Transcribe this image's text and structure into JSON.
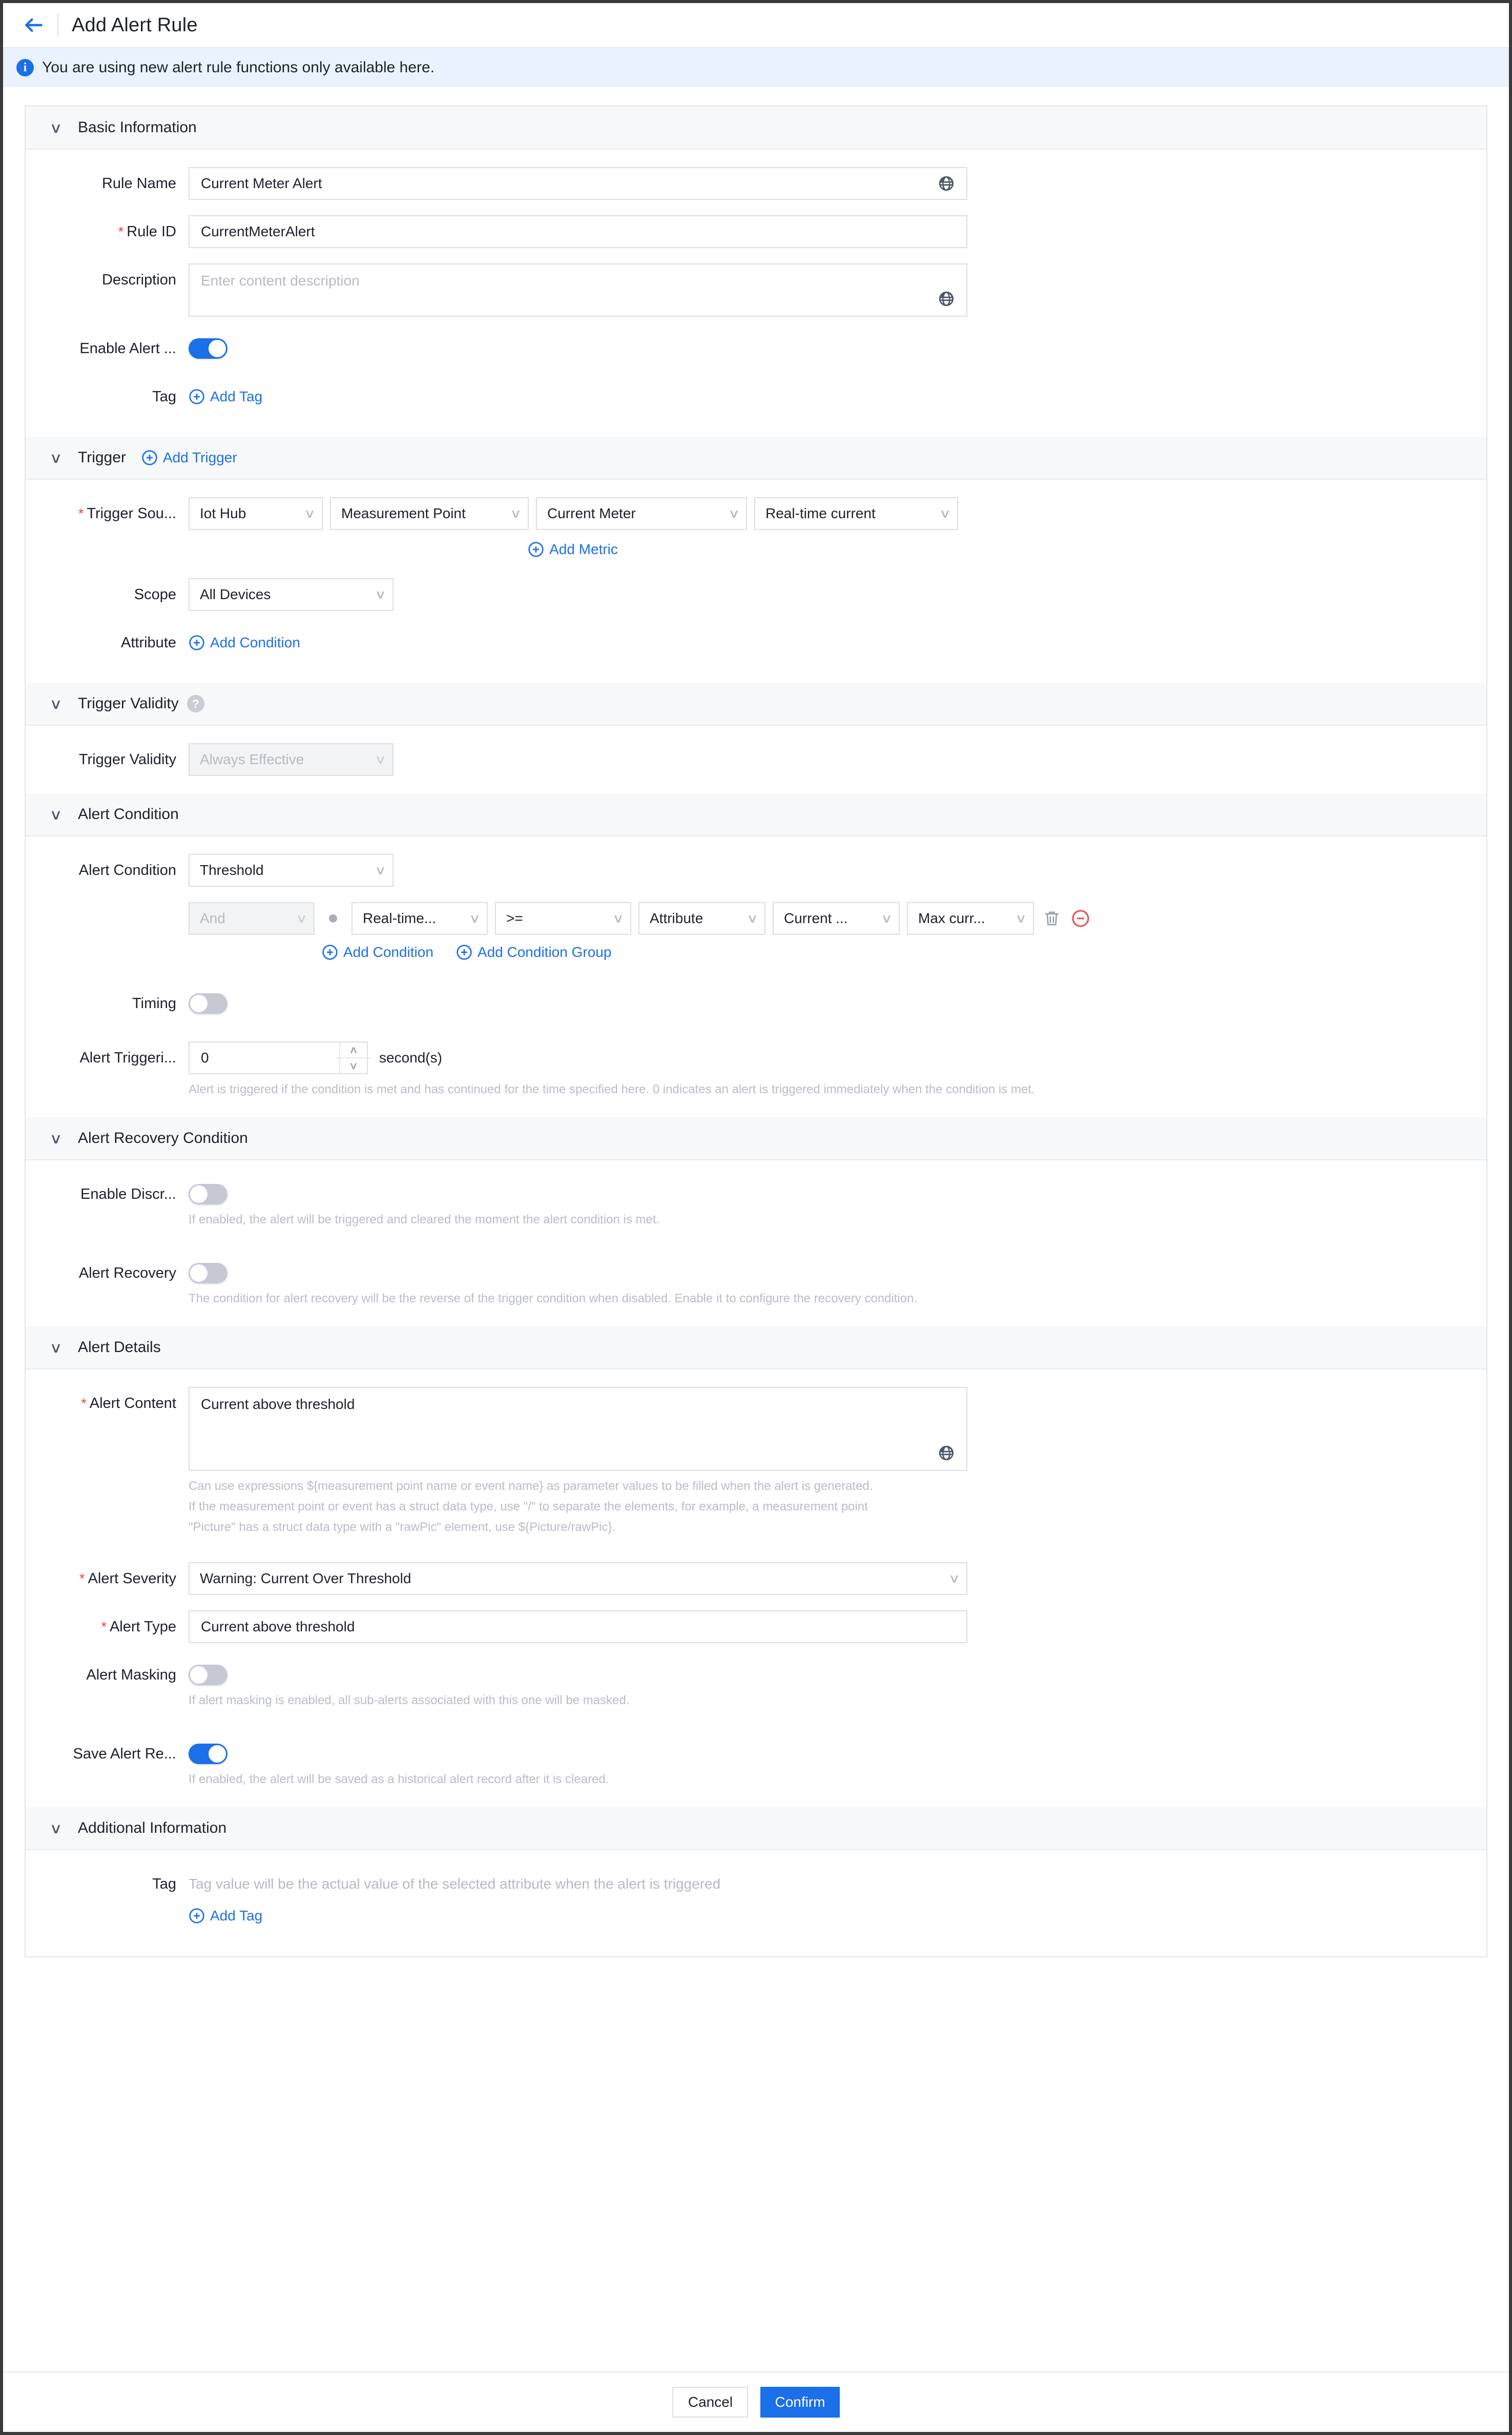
{
  "header": {
    "title": "Add Alert Rule",
    "back_icon": "arrow-left-icon"
  },
  "notice": {
    "icon": "info-icon",
    "text": "You are using new alert rule functions only available here."
  },
  "sections": {
    "basic": {
      "title": "Basic Information",
      "rule_name_label": "Rule Name",
      "rule_name_value": "Current Meter Alert",
      "rule_id_label": "Rule ID",
      "rule_id_value": "CurrentMeterAlert",
      "description_label": "Description",
      "description_placeholder": "Enter content description",
      "enable_alert_label": "Enable Alert ...",
      "enable_alert_state": "on",
      "tag_label": "Tag",
      "add_tag_label": "Add Tag"
    },
    "trigger": {
      "title": "Trigger",
      "add_trigger_label": "Add Trigger",
      "trigger_source_label": "Trigger Sou...",
      "source_1": "Iot Hub",
      "source_2": "Measurement Point",
      "source_3": "Current Meter",
      "source_4": "Real-time current",
      "add_metric_label": "Add Metric",
      "scope_label": "Scope",
      "scope_value": "All Devices",
      "attribute_label": "Attribute",
      "add_condition_label": "Add Condition"
    },
    "trigger_validity": {
      "title": "Trigger Validity",
      "field_label": "Trigger Validity",
      "value": "Always Effective"
    },
    "alert_condition": {
      "title": "Alert Condition",
      "field_label": "Alert Condition",
      "type_value": "Threshold",
      "logic_value": "And",
      "metric_value": "Real-time...",
      "operator_value": ">=",
      "source_value": "Attribute",
      "object_value": "Current ...",
      "attribute_value": "Max curr...",
      "delete_icon": "trash-icon",
      "remove_icon": "minus-circle-icon",
      "add_condition_label": "Add Condition",
      "add_condition_group_label": "Add Condition Group",
      "timing_label": "Timing",
      "timing_state": "off",
      "trigger_time_label": "Alert Triggeri...",
      "trigger_time_value": "0",
      "trigger_time_unit": "second(s)",
      "trigger_time_help": "Alert is triggered if the condition is met and has continued for the time specified here. 0 indicates an alert is triggered immediately when the condition is met."
    },
    "alert_recovery": {
      "title": "Alert Recovery Condition",
      "discrete_label": "Enable Discr...",
      "discrete_state": "off",
      "discrete_help": "If enabled, the alert will be triggered and cleared the moment the alert condition is met.",
      "recovery_label": "Alert Recovery",
      "recovery_state": "off",
      "recovery_help": "The condition for alert recovery will be the reverse of the trigger condition when disabled. Enable it to configure the recovery condition."
    },
    "alert_details": {
      "title": "Alert Details",
      "content_label": "Alert Content",
      "content_value": "Current above threshold",
      "content_help_1": "Can use expressions ${measurement point name or event name} as parameter values to be filled when the alert is generated.",
      "content_help_2": "If the measurement point or event has a struct data type, use \"/\" to separate the elements, for example, a measurement point",
      "content_help_3": "\"Picture\" has a struct data type with a \"rawPic\" element, use ${Picture/rawPic}.",
      "severity_label": "Alert Severity",
      "severity_value": "Warning: Current Over Threshold",
      "type_label": "Alert Type",
      "type_value": "Current above threshold",
      "masking_label": "Alert Masking",
      "masking_state": "off",
      "masking_help": "If alert masking is enabled, all sub-alerts associated with this one will be masked.",
      "save_record_label": "Save Alert Re...",
      "save_record_state": "on",
      "save_record_help": "If enabled, the alert will be saved as a historical alert record after it is cleared."
    },
    "additional": {
      "title": "Additional Information",
      "tag_label": "Tag",
      "tag_placeholder": "Tag value will be the actual value of the selected attribute when the alert is triggered",
      "add_tag_label": "Add Tag"
    }
  },
  "footer": {
    "cancel_label": "Cancel",
    "confirm_label": "Confirm"
  },
  "colors": {
    "accent": "#1b6fe8",
    "required": "#f53f3f",
    "danger": "#f53f3f"
  }
}
